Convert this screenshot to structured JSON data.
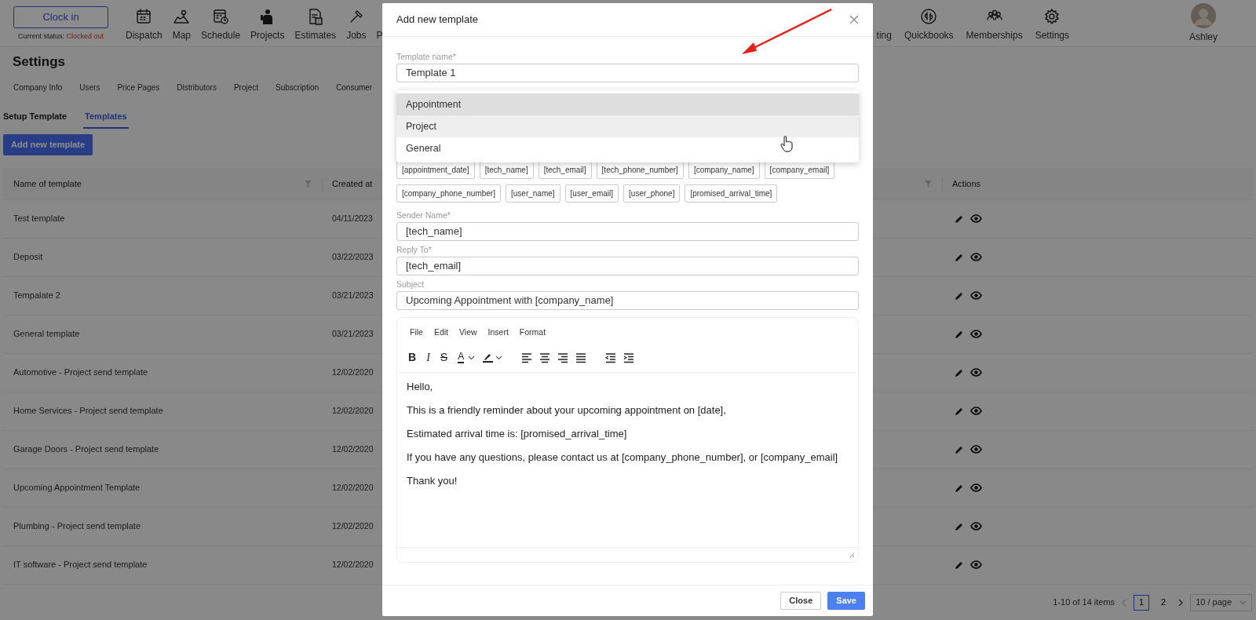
{
  "clock": {
    "button": "Clock in",
    "status_label": "Current status:",
    "status_value": "Clocked out"
  },
  "nav_left": [
    {
      "label": "Dispatch",
      "kind": "calendar"
    },
    {
      "label": "Map",
      "kind": "map"
    },
    {
      "label": "Schedule",
      "kind": "calendar-clock"
    },
    {
      "label": "Projects",
      "kind": "worker"
    },
    {
      "label": "Estimates",
      "kind": "document"
    },
    {
      "label": "Jobs",
      "kind": "hammer"
    },
    {
      "label": "P",
      "kind": "none"
    }
  ],
  "nav_right": [
    {
      "label": "ting",
      "kind": "none"
    },
    {
      "label": "Quickbooks",
      "kind": "logo"
    },
    {
      "label": "Memberships",
      "kind": "people"
    },
    {
      "label": "Settings",
      "kind": "gear"
    }
  ],
  "user": {
    "name": "Ashley"
  },
  "page_title": "Settings",
  "settings_tabs": [
    "Company Info",
    "Users",
    "Price Pages",
    "Distributors",
    "Project",
    "Subscription",
    "Consumer"
  ],
  "sub_tabs": [
    {
      "label": "Setup Template",
      "selected": false
    },
    {
      "label": "Templates",
      "selected": true
    }
  ],
  "add_button": "Add new template",
  "table": {
    "columns": [
      {
        "label": "Name of template",
        "filter": true
      },
      {
        "label": "Created at",
        "filter": false
      },
      {
        "filter": true
      },
      {
        "label": "Actions",
        "filter": false
      }
    ],
    "rows": [
      {
        "name": "Test template",
        "created": "04/11/2023"
      },
      {
        "name": "Deposit",
        "created": "03/22/2023"
      },
      {
        "name": "Tempalate 2",
        "created": "03/21/2023"
      },
      {
        "name": "General template",
        "created": "03/21/2023"
      },
      {
        "name": "Automotive - Project send template",
        "created": "12/02/2020"
      },
      {
        "name": "Home Services - Project send template",
        "created": "12/02/2020"
      },
      {
        "name": "Garage Doors - Project send template",
        "created": "12/02/2020"
      },
      {
        "name": "Upcoming Appointment Template",
        "created": "12/02/2020"
      },
      {
        "name": "Plumbing - Project send template",
        "created": "12/02/2020"
      },
      {
        "name": "IT software - Project send template",
        "created": "12/02/2020"
      }
    ]
  },
  "pagination": {
    "summary": "1-10 of 14 items",
    "pages": [
      {
        "label": "1",
        "selected": true
      },
      {
        "label": "2",
        "selected": false
      }
    ],
    "page_size": "10 / page"
  },
  "modal": {
    "title": "Add new template",
    "name_field": {
      "label": "Template name*",
      "value": "Template 1"
    },
    "type_options": [
      {
        "label": "Appointment",
        "selected": true,
        "hovered": false
      },
      {
        "label": "Project",
        "selected": false,
        "hovered": true
      },
      {
        "label": "General",
        "selected": false,
        "hovered": false
      }
    ],
    "variables": [
      "[appointment_date]",
      "[tech_name]",
      "[tech_email]",
      "[tech_phone_number]",
      "[company_name]",
      "[company_email]",
      "[company_phone_number]",
      "[user_name]",
      "[user_email]",
      "[user_phone]",
      "[promised_arrival_time]"
    ],
    "fields": [
      {
        "label": "Sender Name*",
        "value": "[tech_name]"
      },
      {
        "label": "Reply To*",
        "value": "[tech_email]"
      },
      {
        "label": "Subject",
        "value": "Upcoming Appointment with [company_name]"
      }
    ],
    "editor": {
      "menu": [
        "File",
        "Edit",
        "View",
        "Insert",
        "Format"
      ],
      "toolbar": [
        {
          "items": [
            {
              "kind": "bold",
              "label": "B"
            },
            {
              "kind": "italic",
              "label": "I"
            },
            {
              "kind": "strike",
              "label": "S"
            },
            {
              "kind": "text-color",
              "label": "A",
              "caret": true
            },
            {
              "kind": "highlight",
              "caret": true
            }
          ]
        },
        {
          "items": [
            {
              "kind": "align-left"
            },
            {
              "kind": "align-center"
            },
            {
              "kind": "align-right"
            },
            {
              "kind": "justify"
            }
          ]
        },
        {
          "items": [
            {
              "kind": "outdent"
            },
            {
              "kind": "indent"
            }
          ]
        }
      ],
      "paragraphs": [
        "Hello,",
        "This is a friendly reminder about your upcoming appointment on [date],",
        "Estimated arrival time is: [promised_arrival_time]",
        "If you have any questions, please contact us at [company_phone_number], or [company_email]",
        "Thank you!"
      ]
    },
    "buttons": [
      {
        "label": "Close",
        "kind": "secondary"
      },
      {
        "label": "Save",
        "kind": "primary"
      }
    ]
  }
}
